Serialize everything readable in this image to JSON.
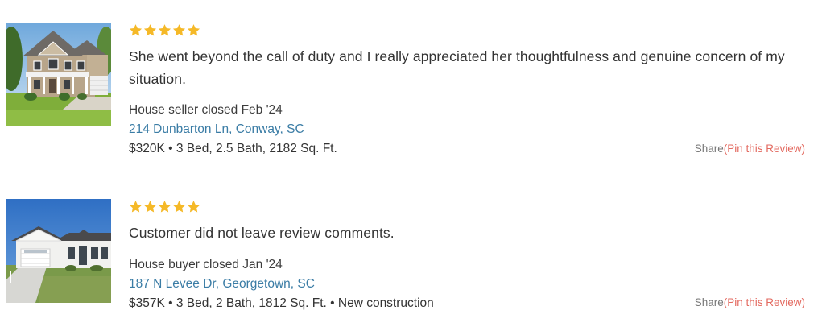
{
  "colors": {
    "star": "#f5b928",
    "link": "#3a7ca5",
    "pin": "#e36a60",
    "share": "#777777",
    "text": "#333333"
  },
  "reviews": [
    {
      "rating": 5,
      "image_icon": "house-photo",
      "comment": "She went beyond the call of duty and I really appreciated her thoughtfulness and genuine concern of my situation.",
      "closed": "House seller closed Feb '24",
      "address": "214 Dunbarton Ln, Conway, SC",
      "details": "$320K • 3 Bed, 2.5 Bath, 2182 Sq. Ft.",
      "share_label": "Share",
      "pin_label": "(Pin this Review)"
    },
    {
      "rating": 5,
      "image_icon": "house-photo",
      "comment": "Customer did not leave review comments.",
      "closed": "House buyer closed Jan '24",
      "address": "187 N Levee Dr, Georgetown, SC",
      "details": "$357K • 3 Bed, 2 Bath, 1812 Sq. Ft. • New construction",
      "share_label": "Share",
      "pin_label": "(Pin this Review)"
    }
  ]
}
